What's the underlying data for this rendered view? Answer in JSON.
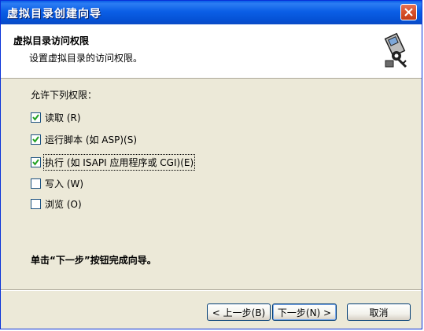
{
  "window": {
    "title": "虚拟目录创建向导"
  },
  "header": {
    "title": "虚拟目录访问权限",
    "subtitle": "设置虚拟目录的访问权限。"
  },
  "permissions": {
    "label": "允许下列权限：",
    "items": [
      {
        "label": "读取 (R)",
        "checked": true
      },
      {
        "label": "运行脚本 (如 ASP)(S)",
        "checked": true
      },
      {
        "label": "执行 (如 ISAPI 应用程序或 CGI)(E)",
        "checked": true
      },
      {
        "label": "写入 (W)",
        "checked": false
      },
      {
        "label": "浏览 (O)",
        "checked": false
      }
    ]
  },
  "instruction": "单击“下一步”按钮完成向导。",
  "buttons": {
    "back": "< 上一步(B)",
    "next": "下一步(N) >",
    "cancel": "取消"
  },
  "colors": {
    "titlebar": "#0554d6",
    "dialog_bg": "#ece9d8",
    "close_button": "#d8502a"
  }
}
